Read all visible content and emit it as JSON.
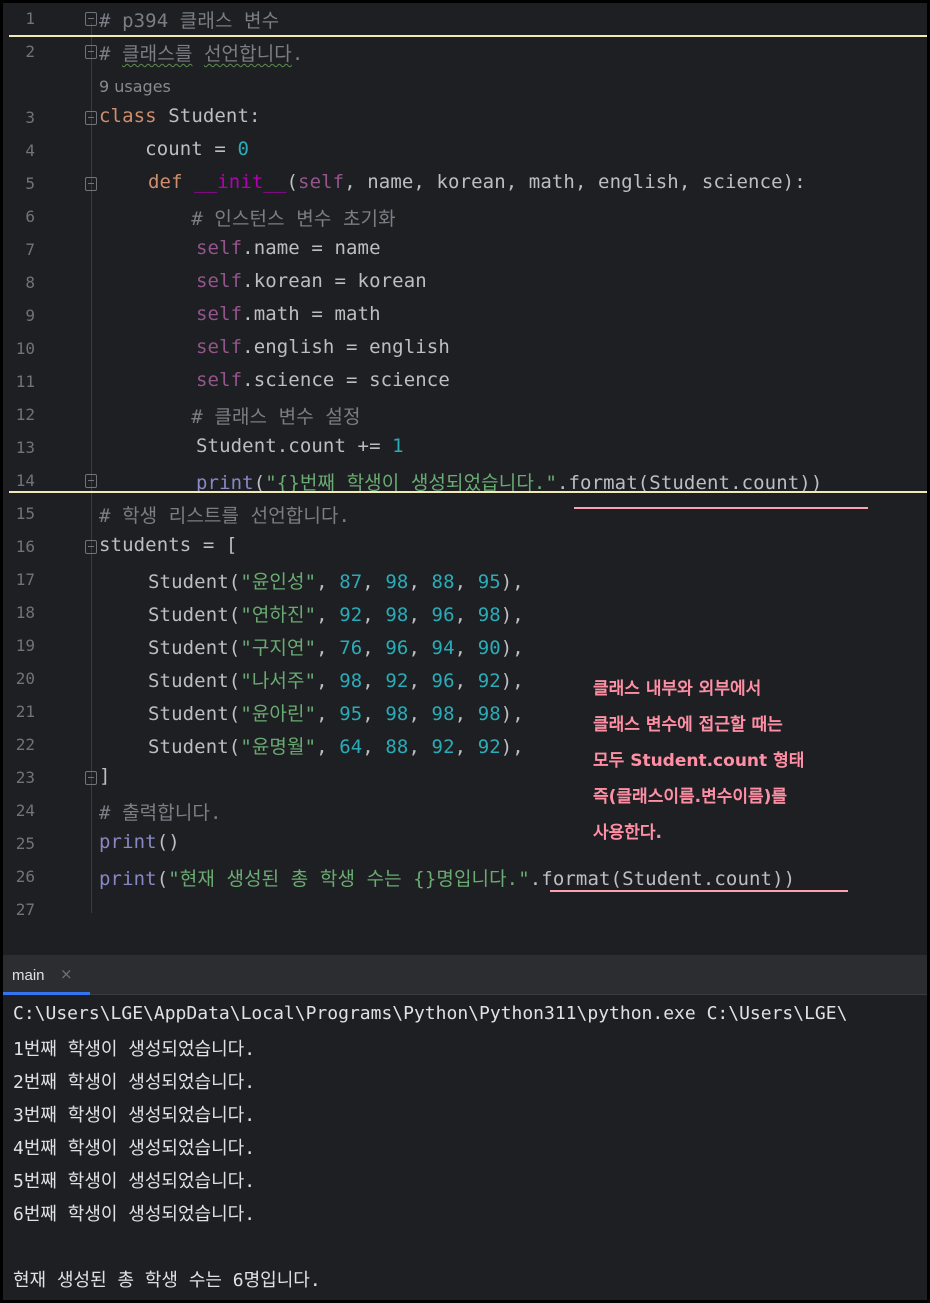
{
  "editor": {
    "usages": "9 usages",
    "lines": [
      {
        "n": "1"
      },
      {
        "n": "2"
      },
      {
        "n": "3"
      },
      {
        "n": "4"
      },
      {
        "n": "5"
      },
      {
        "n": "6"
      },
      {
        "n": "7"
      },
      {
        "n": "8"
      },
      {
        "n": "9"
      },
      {
        "n": "10"
      },
      {
        "n": "11"
      },
      {
        "n": "12"
      },
      {
        "n": "13"
      },
      {
        "n": "14"
      },
      {
        "n": "15"
      },
      {
        "n": "16"
      },
      {
        "n": "17"
      },
      {
        "n": "18"
      },
      {
        "n": "19"
      },
      {
        "n": "20"
      },
      {
        "n": "21"
      },
      {
        "n": "22"
      },
      {
        "n": "23"
      },
      {
        "n": "24"
      },
      {
        "n": "25"
      },
      {
        "n": "26"
      },
      {
        "n": "27"
      }
    ],
    "code": {
      "l1": "# p394 클래스 변수",
      "l2a": "# ",
      "l2b": "클래스를",
      "l2c": " ",
      "l2d": "선언합니다",
      "l2e": ".",
      "l3kw": "class",
      "l3rest": " Student:",
      "l4a": "    count = ",
      "l4num": "0",
      "l5kw": "def",
      "l5sp": " ",
      "l5fn": "__init__",
      "l5p1": "(",
      "l5self": "self",
      "l5rest": ", name, korean, math, english, science):",
      "l6": "        # 인스턴스 변수 초기화",
      "l7self": "self",
      "l7rest": ".name = name",
      "l8self": "self",
      "l8rest": ".korean = korean",
      "l9self": "self",
      "l9rest": ".math = math",
      "l10self": "self",
      "l10rest": ".english = english",
      "l11self": "self",
      "l11rest": ".science = science",
      "l12": "        # 클래스 변수 설정",
      "l13a": "Student.count += ",
      "l13num": "1",
      "l14bi": "print",
      "l14p": "(",
      "l14str": "\"{}번째 학생이 생성되었습니다.\"",
      "l14rest": ".format(Student.count))",
      "l15": "# 학생 리스트를 선언합니다.",
      "l16": "students = [",
      "students": [
        {
          "name": "\"윤인성\"",
          "v1": "87",
          "v2": "98",
          "v3": "88",
          "v4": "95"
        },
        {
          "name": "\"연하진\"",
          "v1": "92",
          "v2": "98",
          "v3": "96",
          "v4": "98"
        },
        {
          "name": "\"구지연\"",
          "v1": "76",
          "v2": "96",
          "v3": "94",
          "v4": "90"
        },
        {
          "name": "\"나서주\"",
          "v1": "98",
          "v2": "92",
          "v3": "96",
          "v4": "92"
        },
        {
          "name": "\"윤아린\"",
          "v1": "95",
          "v2": "98",
          "v3": "98",
          "v4": "98"
        },
        {
          "name": "\"윤명월\"",
          "v1": "64",
          "v2": "88",
          "v3": "92",
          "v4": "92"
        }
      ],
      "student_fn": "Student(",
      "l23": "]",
      "l24": "# 출력합니다.",
      "l25bi": "print",
      "l25rest": "()",
      "l26bi": "print",
      "l26p": "(",
      "l26str": "\"현재 생성된 총 학생 수는 {}명입니다.\"",
      "l26rest": ".format(Student.count))"
    }
  },
  "annotation": {
    "lines": [
      "클래스 내부와 외부에서",
      "클래스 변수에 접근할 때는",
      "모두 Student.count 형태",
      "즉(클래스이름.변수이름)를",
      "사용한다."
    ]
  },
  "run_panel": {
    "tab_label": "main",
    "close_glyph": "×",
    "output": [
      "C:\\Users\\LGE\\AppData\\Local\\Programs\\Python\\Python311\\python.exe C:\\Users\\LGE\\",
      "1번째 학생이 생성되었습니다.",
      "2번째 학생이 생성되었습니다.",
      "3번째 학생이 생성되었습니다.",
      "4번째 학생이 생성되었습니다.",
      "5번째 학생이 생성되었습니다.",
      "6번째 학생이 생성되었습니다.",
      "",
      "현재 생성된 총 학생 수는 6명입니다."
    ]
  },
  "colors": {
    "background": "#1e1f22",
    "keyword": "#cf8e6d",
    "self": "#94558d",
    "number": "#2aacb8",
    "string": "#6aab73",
    "comment": "#7a7e85",
    "annotation": "#ff8fa5",
    "highlight_border": "#f3e9b5"
  }
}
